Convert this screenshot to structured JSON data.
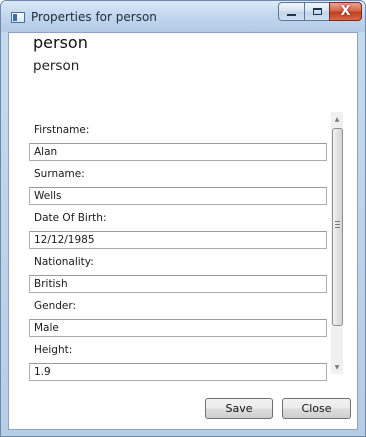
{
  "window": {
    "title": "Properties for person",
    "close_glyph": "X"
  },
  "header": {
    "title": "person",
    "subtitle": "person"
  },
  "fields": [
    {
      "label": "Firstname:",
      "value": "Alan"
    },
    {
      "label": "Surname:",
      "value": "Wells"
    },
    {
      "label": "Date Of Birth:",
      "value": "12/12/1985"
    },
    {
      "label": "Nationality:",
      "value": "British"
    },
    {
      "label": "Gender:",
      "value": "Male"
    },
    {
      "label": "Height:",
      "value": "1.9"
    }
  ],
  "scrollbar": {
    "up_glyph": "▲",
    "down_glyph": "▼"
  },
  "actions": {
    "save_label": "Save",
    "close_label": "Close"
  }
}
